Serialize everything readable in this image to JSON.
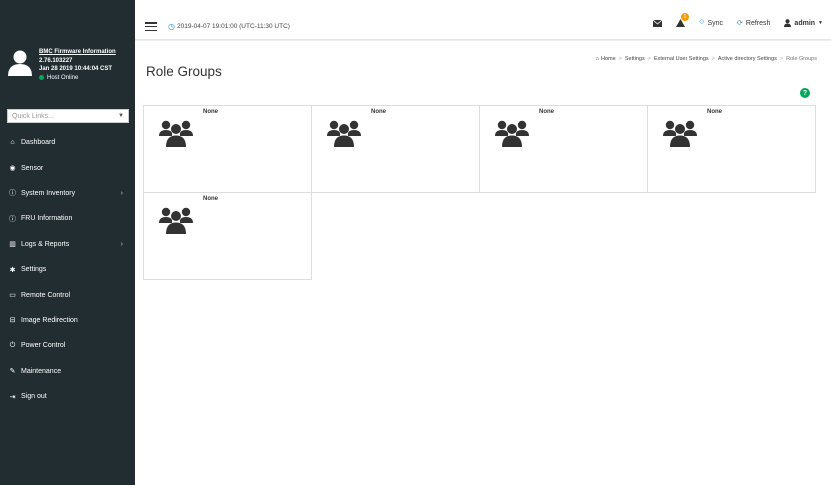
{
  "sidebar": {
    "firmware_link": "BMC Firmware Information",
    "firmware_version": "2.76.103227",
    "firmware_date": "Jan 28 2019 10:44:04 CST",
    "host_status": "Host Online",
    "quick_links_placeholder": "Quick Links...",
    "items": [
      {
        "label": "Dashboard",
        "icon": "dashboard-icon",
        "has_arrow": false
      },
      {
        "label": "Sensor",
        "icon": "sensor-icon",
        "has_arrow": false
      },
      {
        "label": "System Inventory",
        "icon": "info-icon",
        "has_arrow": true
      },
      {
        "label": "FRU Information",
        "icon": "info-icon",
        "has_arrow": false
      },
      {
        "label": "Logs & Reports",
        "icon": "chart-icon",
        "has_arrow": true
      },
      {
        "label": "Settings",
        "icon": "gear-icon",
        "has_arrow": false
      },
      {
        "label": "Remote Control",
        "icon": "monitor-icon",
        "has_arrow": false
      },
      {
        "label": "Image Redirection",
        "icon": "drive-icon",
        "has_arrow": false
      },
      {
        "label": "Power Control",
        "icon": "power-icon",
        "has_arrow": false
      },
      {
        "label": "Maintenance",
        "icon": "wrench-icon",
        "has_arrow": false
      },
      {
        "label": "Sign out",
        "icon": "sign-out-icon",
        "has_arrow": false
      }
    ]
  },
  "header": {
    "datetime": "2019-04-07 19:01:00 (UTC-11:30 UTC)",
    "notification_count": "1",
    "sync_label": "Sync",
    "refresh_label": "Refresh",
    "user_label": "admin"
  },
  "content": {
    "title": "Role Groups",
    "breadcrumb": [
      "Home",
      "Settings",
      "External User Settings",
      "Active directory Settings",
      "Role Groups"
    ],
    "role_groups": [
      {
        "name": "None"
      },
      {
        "name": "None"
      },
      {
        "name": "None"
      },
      {
        "name": "None"
      },
      {
        "name": "None"
      }
    ]
  },
  "colors": {
    "sidebar_bg": "#222d32",
    "accent": "#3c8dbc",
    "status_green": "#00a65a",
    "badge_orange": "#f39c12"
  }
}
